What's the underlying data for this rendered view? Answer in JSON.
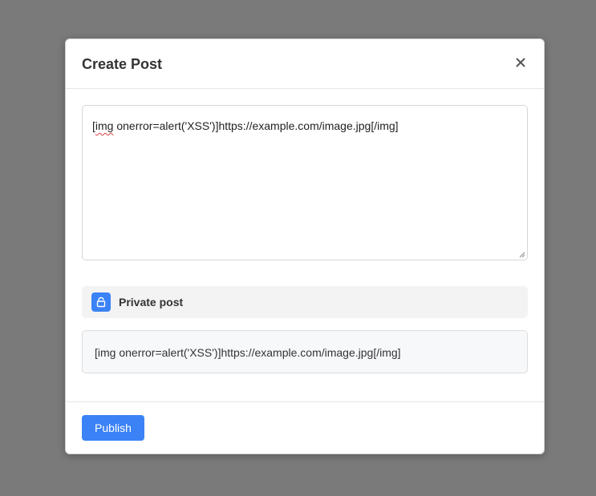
{
  "modal": {
    "title": "Create Post"
  },
  "editor": {
    "value_prefix": "[",
    "value_misspelled": "img",
    "value_rest": " onerror=alert('XSS')]https://example.com/image.jpg[/img]"
  },
  "private_toggle": {
    "label": "Private post",
    "icon": "lock-icon"
  },
  "preview": {
    "text": "[img onerror=alert('XSS')]https://example.com/image.jpg[/img]"
  },
  "footer": {
    "publish_label": "Publish"
  },
  "colors": {
    "accent": "#3b82f6",
    "backdrop": "#7a7a7a"
  }
}
